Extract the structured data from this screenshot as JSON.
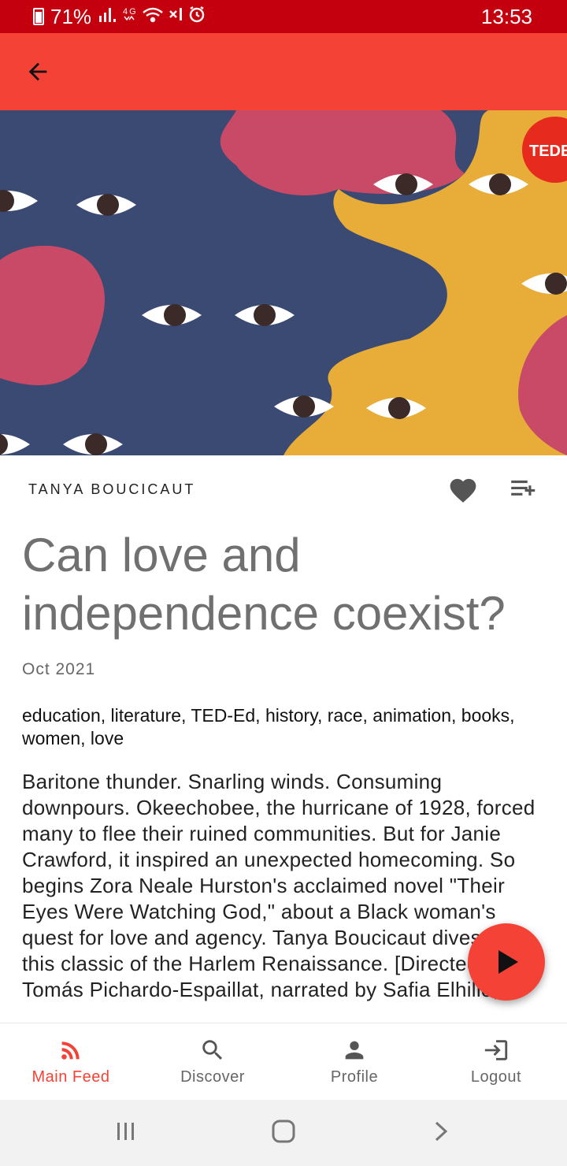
{
  "status_bar": {
    "battery": "71%",
    "time": "13:53",
    "icons": [
      "signal-icon",
      "4g-icon",
      "wifi-icon",
      "mute-icon",
      "alarm-icon"
    ]
  },
  "app_bar": {
    "back_icon": "arrow-back-icon"
  },
  "hero": {
    "badge": "TEDE"
  },
  "talk": {
    "author": "TANYA BOUCICAUT",
    "title": "Can love and independence coexist?",
    "date": "Oct 2021",
    "tags": "education, literature, TED-Ed, history, race, animation, books, women, love",
    "description": "Baritone thunder. Snarling winds. Consuming downpours. Okeechobee, the hurricane of 1928, forced many to flee their ruined communities. But for Janie Crawford, it inspired an unexpected homecoming. So begins Zora Neale Hurston's acclaimed novel \"Their Eyes Were Watching God,\" about a Black woman's quest for love and agency. Tanya Boucicaut dives into this classic of the Harlem Renaissance. [Directed by Tomás Pichardo-Espaillat, narrated by Safia Elhillo,"
  },
  "actions": {
    "favorite_icon": "heart-icon",
    "add_to_playlist_icon": "playlist-add-icon",
    "play_icon": "play-icon"
  },
  "bottom_nav": [
    {
      "label": "Main Feed",
      "icon": "rss-icon",
      "active": true
    },
    {
      "label": "Discover",
      "icon": "search-icon",
      "active": false
    },
    {
      "label": "Profile",
      "icon": "person-icon",
      "active": false
    },
    {
      "label": "Logout",
      "icon": "logout-icon",
      "active": false
    }
  ],
  "colors": {
    "accent": "#f44336",
    "status_bar": "#c4000f",
    "navy": "#3a4a72",
    "pink": "#c94a66",
    "mustard": "#e8ad38"
  }
}
